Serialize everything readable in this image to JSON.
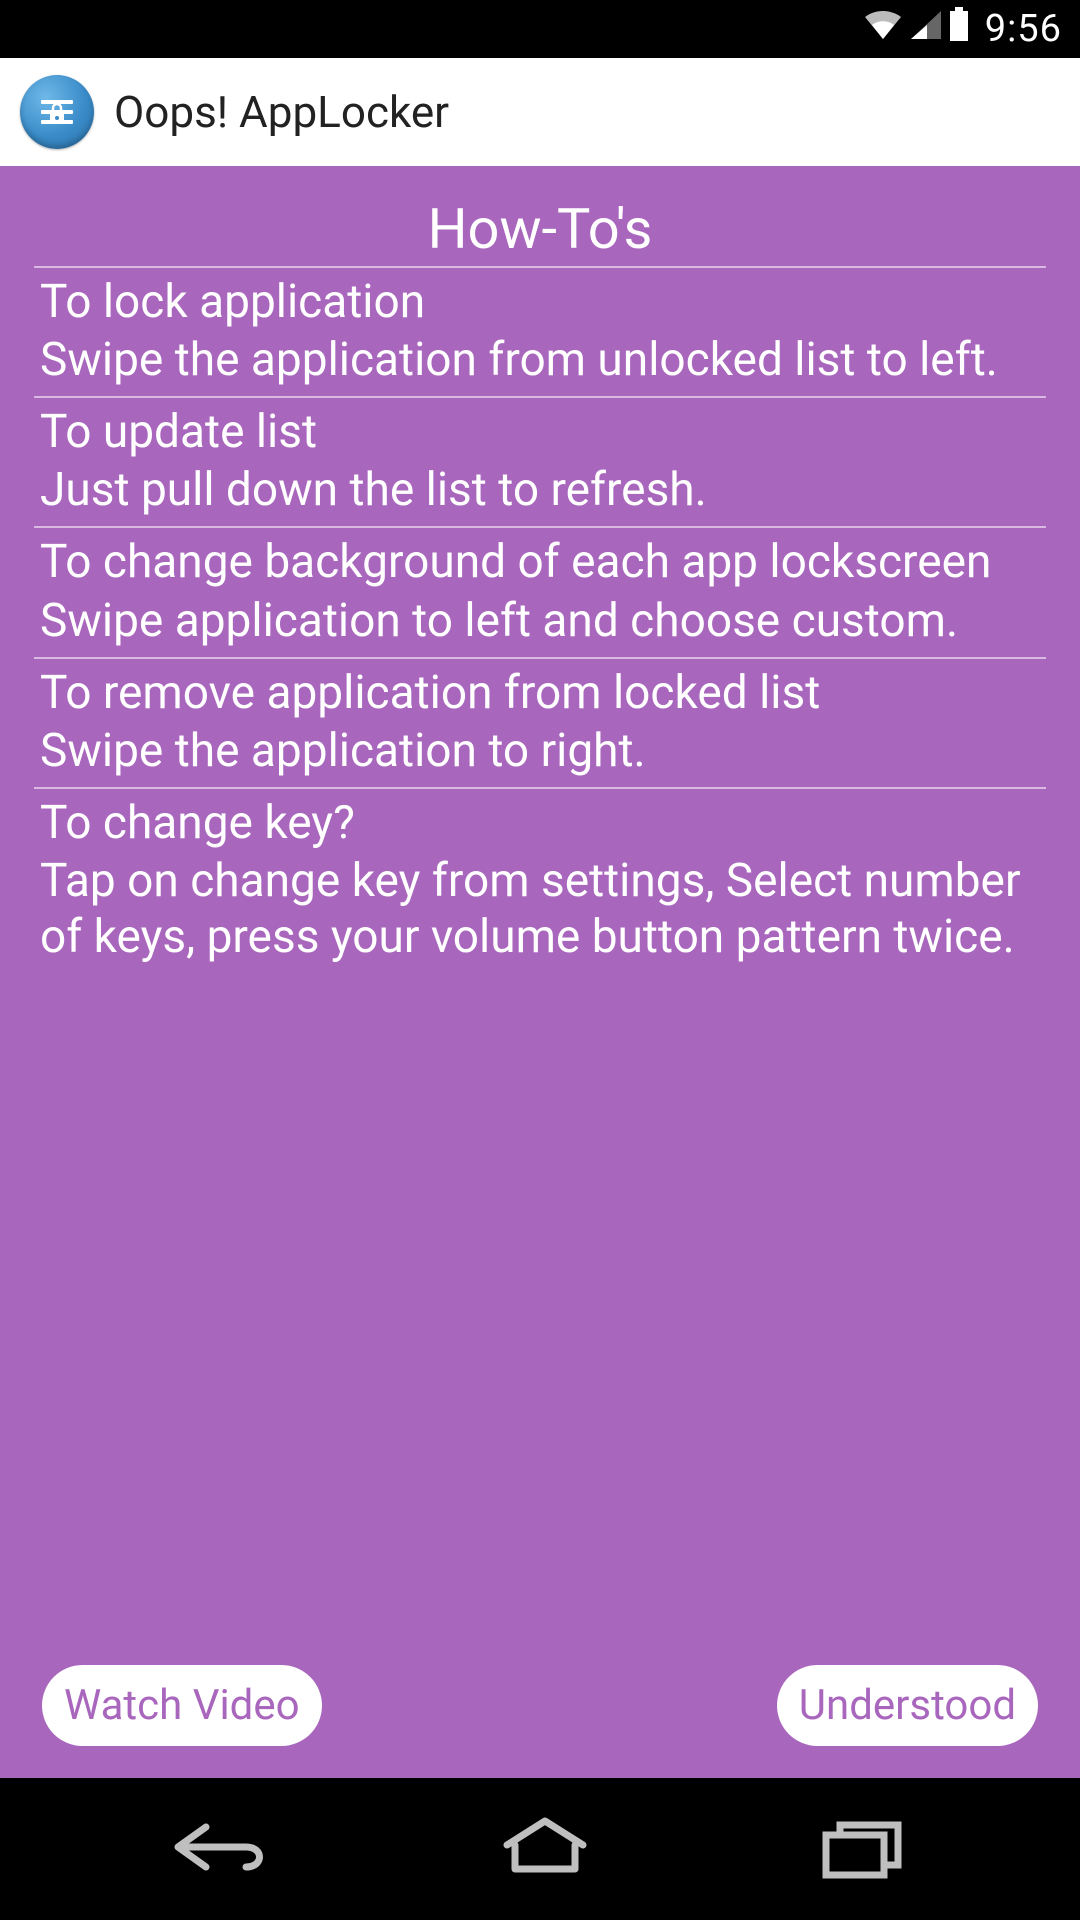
{
  "status": {
    "time": "9:56"
  },
  "action_bar": {
    "title": "Oops! AppLocker"
  },
  "page": {
    "title": "How-To's"
  },
  "items": [
    {
      "title": "To lock application",
      "body": "Swipe the application from unlocked list to left."
    },
    {
      "title": "To update list",
      "body": "Just pull down the list to refresh."
    },
    {
      "title": "To change background of each app lockscreen",
      "body": "Swipe application to left and choose custom."
    },
    {
      "title": "To remove application from locked list",
      "body": "Swipe the application to right."
    },
    {
      "title": "To change key?",
      "body": "Tap on change key from settings, Select number of keys, press your volume button pattern twice."
    }
  ],
  "buttons": {
    "watch": "Watch Video",
    "understood": "Understood"
  }
}
